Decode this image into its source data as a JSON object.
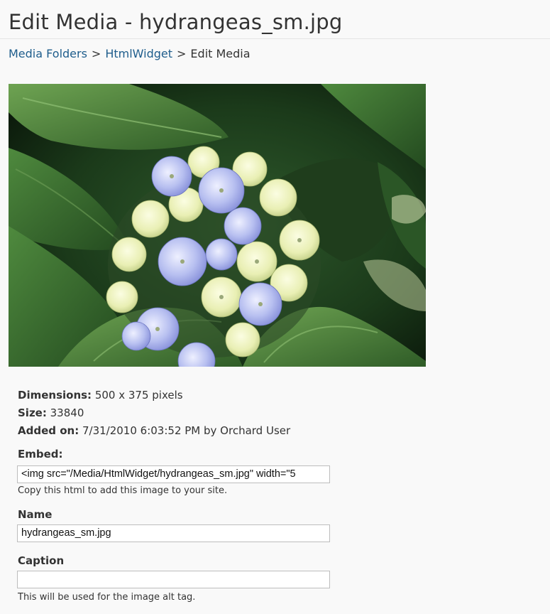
{
  "page": {
    "title": "Edit Media - hydrangeas_sm.jpg"
  },
  "breadcrumb": {
    "items": [
      "Media Folders",
      "HtmlWidget",
      "Edit Media"
    ],
    "separator": ">"
  },
  "image": {
    "subject": "photo of a pale blue and cream hydrangea among green leaves"
  },
  "details": {
    "dimensions_label": "Dimensions:",
    "dimensions_value": "500 x 375 pixels",
    "size_label": "Size:",
    "size_value": "33840",
    "added_label": "Added on:",
    "added_value": "7/31/2010 6:03:52 PM by Orchard User"
  },
  "embed": {
    "label": "Embed:",
    "value": "<img src=\"/Media/HtmlWidget/hydrangeas_sm.jpg\" width=\"5",
    "hint": "Copy this html to add this image to your site."
  },
  "name": {
    "label": "Name",
    "value": "hydrangeas_sm.jpg"
  },
  "caption": {
    "label": "Caption",
    "value": "",
    "hint": "This will be used for the image alt tag."
  },
  "colors": {
    "link": "#1e5d8c",
    "text": "#333333",
    "background": "#f9f9f9"
  }
}
